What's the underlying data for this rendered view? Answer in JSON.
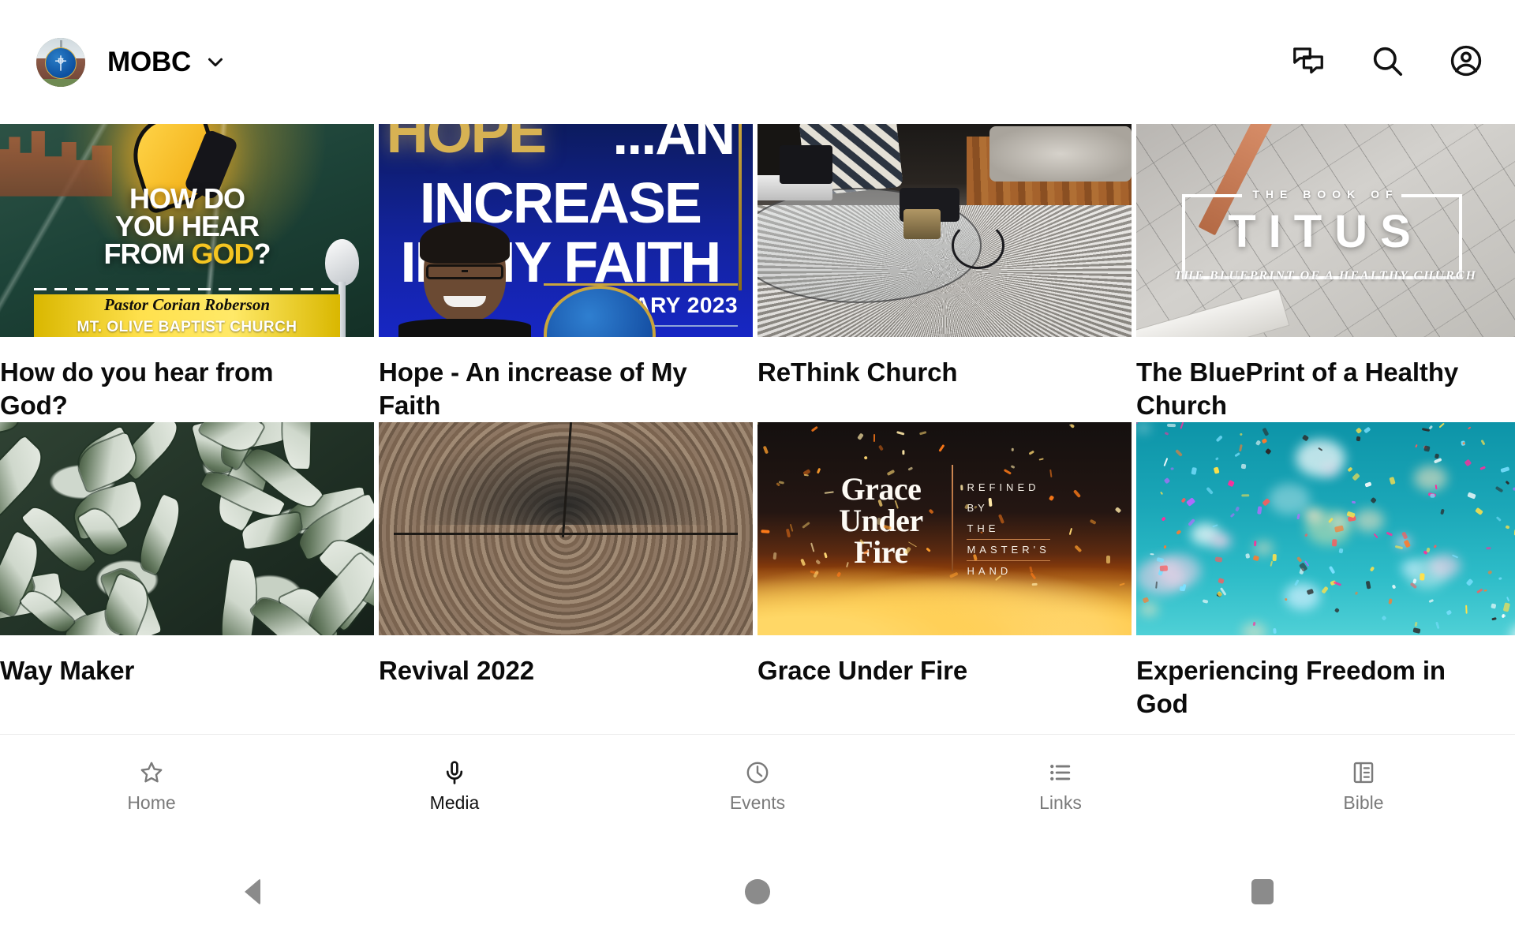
{
  "appbar": {
    "brand_name": "MOBC",
    "avatar_icon": "church-logo-avatar",
    "caret_icon": "chevron-down-icon",
    "actions": [
      {
        "icon": "chat-bubbles-icon",
        "name": "messages-button"
      },
      {
        "icon": "search-icon",
        "name": "search-button"
      },
      {
        "icon": "account-circle-icon",
        "name": "account-button"
      }
    ]
  },
  "media": {
    "items": [
      {
        "title": "How do you hear from God?",
        "art": "art-hear",
        "overlay": {
          "line1": "HOW DO",
          "line2": "YOU HEAR",
          "line3_pre": "FROM ",
          "line3_gold": "GOD",
          "line3_post": "?",
          "speaker": "Pastor Corian Roberson",
          "org": "MT. OLIVE BAPTIST CHURCH"
        }
      },
      {
        "title": "Hope - An increase of My Faith",
        "art": "art-hope",
        "overlay": {
          "word_hope": "HOPE",
          "line1": "...AN",
          "line2": "INCREASE",
          "line3": "IN MY FAITH",
          "date": "JANUARY 2023"
        }
      },
      {
        "title": "ReThink Church",
        "art": "art-room",
        "overlay": {}
      },
      {
        "title": "The BluePrint of a Healthy Church",
        "art": "art-titus",
        "overlay": {
          "kicker": "THE BOOK OF",
          "big": "TITUS",
          "sub": "THE BLUEPRINT OF A HEALTHY CHURCH"
        }
      },
      {
        "title": "Way Maker",
        "art": "art-leaves",
        "overlay": {}
      },
      {
        "title": "Revival 2022",
        "art": "art-wood",
        "overlay": {}
      },
      {
        "title": "Grace Under Fire",
        "art": "art-fire",
        "overlay": {
          "title_l1": "Grace",
          "title_l2": "Under",
          "title_l3": "Fire",
          "side1": "REFINED",
          "side2": "BY",
          "side3": "THE",
          "side4": "MASTER'S",
          "side5": "HAND"
        }
      },
      {
        "title": "Experiencing Freedom in God",
        "art": "art-confetti",
        "overlay": {}
      }
    ]
  },
  "bottom_nav": {
    "items": [
      {
        "label": "Home",
        "icon": "star-outline-icon",
        "active": false
      },
      {
        "label": "Media",
        "icon": "microphone-icon",
        "active": true
      },
      {
        "label": "Events",
        "icon": "clock-icon",
        "active": false
      },
      {
        "label": "Links",
        "icon": "list-icon",
        "active": false
      },
      {
        "label": "Bible",
        "icon": "menu-book-icon",
        "active": false
      }
    ]
  },
  "system_nav": {
    "items": [
      {
        "name": "android-back-button",
        "icon": "triangle-back-icon"
      },
      {
        "name": "android-home-button",
        "icon": "circle-home-icon"
      },
      {
        "name": "android-recents-button",
        "icon": "square-recents-icon"
      }
    ]
  },
  "colors": {
    "active_nav": "#121212",
    "inactive_nav": "#7a7a7a",
    "background": "#ffffff",
    "divider": "#ececec",
    "system_icon": "#8b8b8b"
  }
}
